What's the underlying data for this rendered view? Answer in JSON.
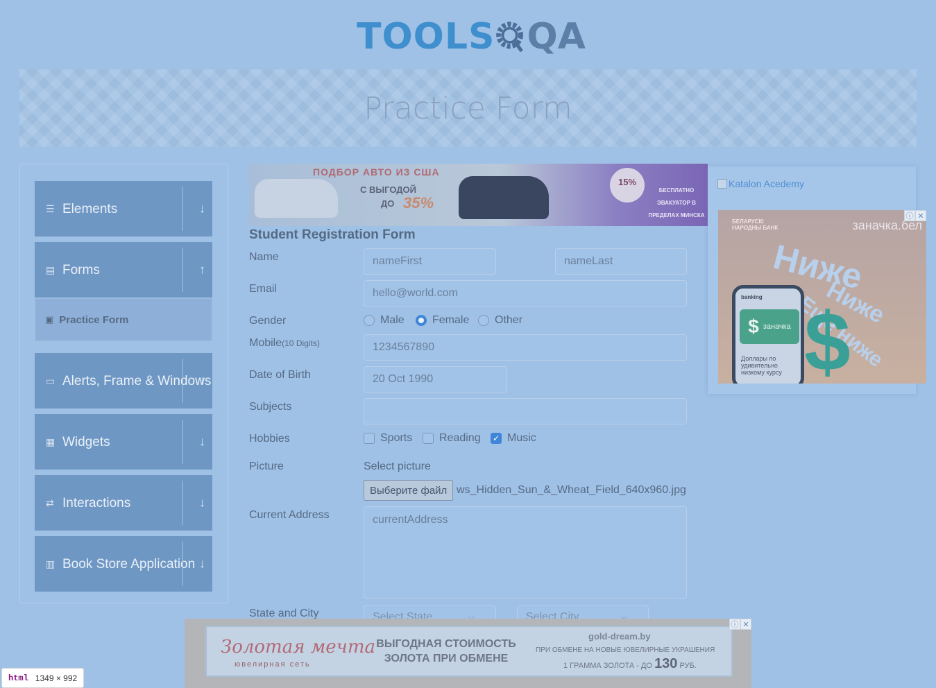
{
  "logo": {
    "brand_left": "TOOLS",
    "brand_right": "QA"
  },
  "banner": {
    "title": "Practice Form"
  },
  "sidebar": {
    "groups": [
      {
        "label": "Elements",
        "icon": "list-icon",
        "arrow": "↓"
      },
      {
        "label": "Forms",
        "icon": "document-icon",
        "arrow": "↑"
      },
      {
        "label": "Alerts, Frame & Windows",
        "icon": "window-icon",
        "arrow": "↓"
      },
      {
        "label": "Widgets",
        "icon": "grid-icon",
        "arrow": "↓"
      },
      {
        "label": "Interactions",
        "icon": "interactions-icon",
        "arrow": "↓"
      },
      {
        "label": "Book Store Application",
        "icon": "books-icon",
        "arrow": "↓"
      }
    ],
    "active_item": "Practice Form"
  },
  "top_ad": {
    "headline": "ПОДБОР АВТО ИЗ США",
    "line2": "С ВЫГОДОЙ",
    "line3": "ДО",
    "percent": "35%",
    "badge": "15%",
    "side_text": "БЕСПЛАТНО ЭВАКУАТОР В ПРЕДЕЛАХ МИНСКА"
  },
  "form": {
    "title": "Student Registration Form",
    "labels": {
      "name": "Name",
      "email": "Email",
      "gender": "Gender",
      "mobile": "Mobile",
      "mobile_hint": "(10 Digits)",
      "dob": "Date of Birth",
      "subjects": "Subjects",
      "hobbies": "Hobbies",
      "picture": "Picture",
      "address": "Current Address",
      "state_city": "State and City"
    },
    "first_name_placeholder": "nameFirst",
    "last_name_placeholder": "nameLast",
    "email_value": "hello@world.com",
    "gender_options": [
      "Male",
      "Female",
      "Other"
    ],
    "gender_selected": "Female",
    "mobile_value": "1234567890",
    "dob_value": "20 Oct 1990",
    "subjects_value": "",
    "hobbies": [
      {
        "label": "Sports",
        "checked": false
      },
      {
        "label": "Reading",
        "checked": false
      },
      {
        "label": "Music",
        "checked": true
      }
    ],
    "picture_prompt": "Select picture",
    "file_button": "Выберите файл",
    "file_name": "ws_Hidden_Sun_&_Wheat_Field_640x960.jpg",
    "address_placeholder": "currentAddress",
    "state_placeholder": "Select State",
    "city_placeholder": "Select City"
  },
  "right_ads": {
    "katalon_alt": "Katalon Acedemy",
    "bank": "БЕЛАРУСКІ НАРОДНЫ БАНК",
    "site": "заначка.бел",
    "line1": "Ниже",
    "line2": "Ниже",
    "line3": "Ещё ниже",
    "phone_app": "banking",
    "phone_button": "заначка",
    "phone_desc": "Доллары по удивительно низкому курсу"
  },
  "bottom_ad": {
    "brand": "Золотая мечта",
    "brand_sub": "ювелирная сеть",
    "headline": "ВЫГОДНАЯ СТОИМОСТЬ ЗОЛОТА ПРИ ОБМЕНЕ",
    "site": "gold-dream.by",
    "small": "ПРИ ОБМЕНЕ НА НОВЫЕ ЮВЕЛИРНЫЕ УКРАШЕНИЯ",
    "price_prefix": "1 ГРАММА ЗОЛОТА - ДО",
    "price_value": "130",
    "price_suffix": "РУБ."
  },
  "devtools": {
    "tag": "html",
    "size": "1349 × 992"
  }
}
